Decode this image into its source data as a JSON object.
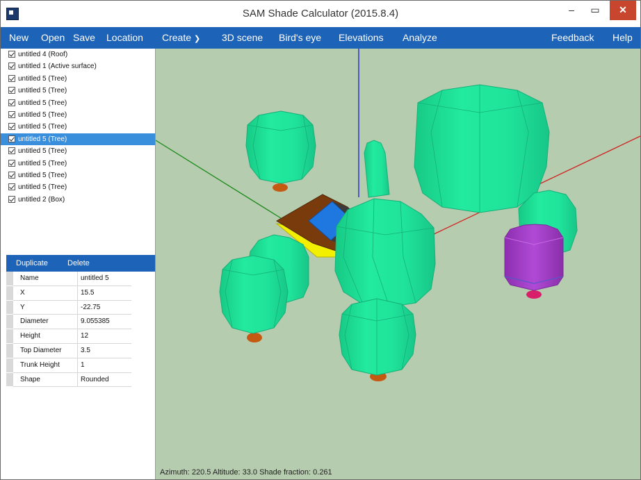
{
  "window": {
    "title": "SAM Shade Calculator (2015.8.4)",
    "controls": {
      "minimize": "–",
      "maximize": "▭",
      "close": "✕"
    }
  },
  "menu": {
    "new": "New",
    "open": "Open",
    "save": "Save",
    "location": "Location",
    "create": "Create",
    "scene3d": "3D scene",
    "birds_eye": "Bird's eye",
    "elevations": "Elevations",
    "analyze": "Analyze",
    "feedback": "Feedback",
    "help": "Help"
  },
  "tree": [
    {
      "label": "untitled 4 (Roof)",
      "checked": true,
      "selected": false
    },
    {
      "label": "untitled 1 (Active surface)",
      "checked": true,
      "selected": false
    },
    {
      "label": "untitled 5 (Tree)",
      "checked": true,
      "selected": false
    },
    {
      "label": "untitled 5 (Tree)",
      "checked": true,
      "selected": false
    },
    {
      "label": "untitled 5 (Tree)",
      "checked": true,
      "selected": false
    },
    {
      "label": "untitled 5 (Tree)",
      "checked": true,
      "selected": false
    },
    {
      "label": "untitled 5 (Tree)",
      "checked": true,
      "selected": false
    },
    {
      "label": "untitled 5 (Tree)",
      "checked": true,
      "selected": true
    },
    {
      "label": "untitled 5 (Tree)",
      "checked": true,
      "selected": false
    },
    {
      "label": "untitled 5 (Tree)",
      "checked": true,
      "selected": false
    },
    {
      "label": "untitled 5 (Tree)",
      "checked": true,
      "selected": false
    },
    {
      "label": "untitled 5 (Tree)",
      "checked": true,
      "selected": false
    },
    {
      "label": "untitled 2 (Box)",
      "checked": true,
      "selected": false
    }
  ],
  "properties": {
    "duplicate_label": "Duplicate",
    "delete_label": "Delete",
    "rows": [
      {
        "name": "Name",
        "value": "untitled 5"
      },
      {
        "name": "X",
        "value": "15.5"
      },
      {
        "name": "Y",
        "value": "-22.75"
      },
      {
        "name": "Diameter",
        "value": "9.055385"
      },
      {
        "name": "Height",
        "value": "12"
      },
      {
        "name": "Top Diameter",
        "value": "3.5"
      },
      {
        "name": "Trunk Height",
        "value": "1"
      },
      {
        "name": "Shape",
        "value": "Rounded"
      }
    ]
  },
  "status": "Azimuth: 220.5   Altitude: 33.0   Shade fraction: 0.261",
  "colors": {
    "accent": "#1d63b8",
    "selection": "#3a8fdd",
    "viewport_bg": "#b6ccaf",
    "tree": "#1fe39a",
    "trunk": "#c45a12",
    "active_surface": "#a13cc4",
    "roof": "#7a3b0c",
    "box_face": "#1f78e0",
    "box_base": "#f2f000"
  }
}
